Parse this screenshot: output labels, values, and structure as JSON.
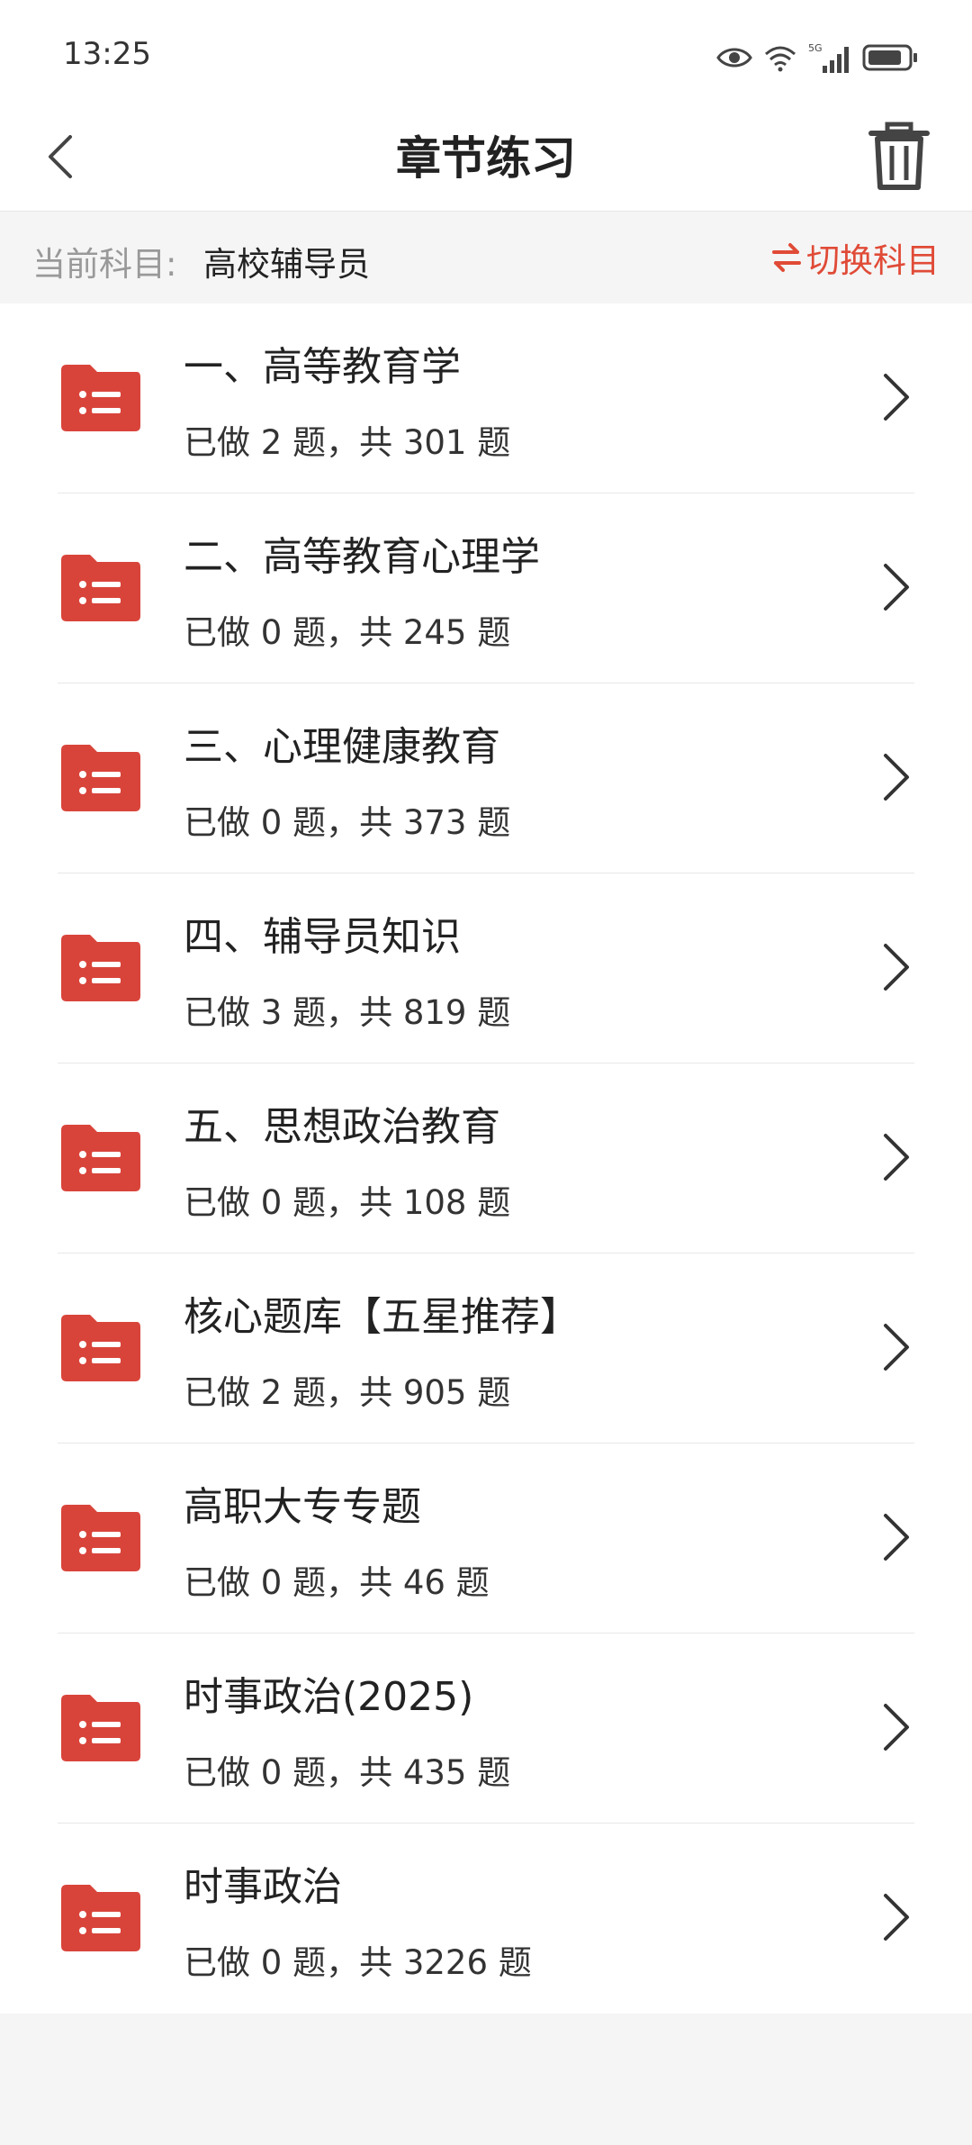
{
  "status_bar": {
    "time": "13:25",
    "icons": [
      "eye-icon",
      "wifi-icon",
      "signal-5g-icon",
      "battery-icon"
    ],
    "network_label": "5G"
  },
  "nav": {
    "title": "章节练习",
    "back_icon": "chevron-left-icon",
    "delete_icon": "trash-icon"
  },
  "subject": {
    "label": "当前科目:",
    "value": "高校辅导员",
    "switch_label": "切换科目",
    "switch_icon": "swap-arrows-icon"
  },
  "colors": {
    "accent": "#e04b37",
    "folder": "#d9443a"
  },
  "chapters": [
    {
      "title": "一、高等教育学",
      "progress": "已做 2 题，共 301 题"
    },
    {
      "title": "二、高等教育心理学",
      "progress": "已做 0 题，共 245 题"
    },
    {
      "title": "三、心理健康教育",
      "progress": "已做 0 题，共 373 题"
    },
    {
      "title": "四、辅导员知识",
      "progress": "已做 3 题，共 819 题"
    },
    {
      "title": "五、思想政治教育",
      "progress": "已做 0 题，共 108 题"
    },
    {
      "title": "核心题库【五星推荐】",
      "progress": "已做 2 题，共 905 题"
    },
    {
      "title": "高职大专专题",
      "progress": "已做 0 题，共 46 题"
    },
    {
      "title": "时事政治(2025)",
      "progress": "已做 0 题，共 435 题"
    },
    {
      "title": "时事政治",
      "progress": "已做 0 题，共 3226 题"
    }
  ]
}
